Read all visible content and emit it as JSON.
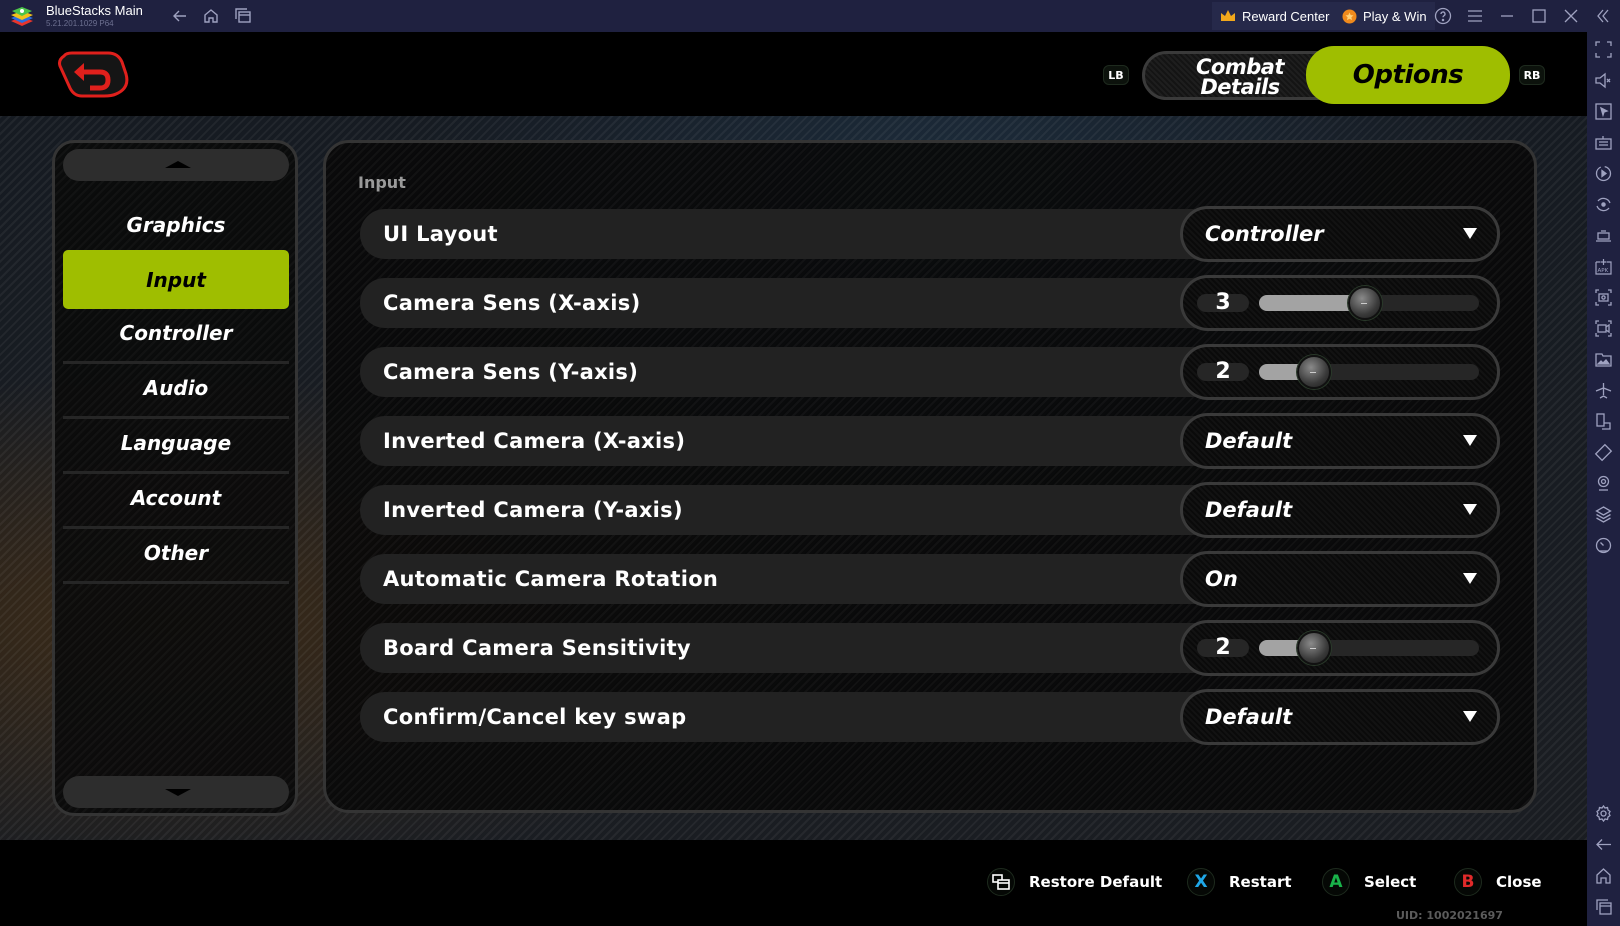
{
  "titlebar": {
    "app_title": "BlueStacks Main",
    "version": "5.21.201.1029  P64",
    "nav_icons": [
      "back-arrow-icon",
      "home-icon",
      "multi-instance-icon"
    ],
    "reward_center": "Reward Center",
    "play_and_win": "Play & Win",
    "window_icons": [
      "help-icon",
      "menu-icon",
      "minimize-icon",
      "maximize-icon",
      "close-icon",
      "collapse-sidebar-icon"
    ]
  },
  "bs_sidebar": {
    "icons": [
      "fullscreen-icon",
      "mute-icon",
      "pointer-icon",
      "keyboard-icon",
      "macro-icon",
      "rotate-icon",
      "performance-icon",
      "install-apk-icon",
      "screenshot-icon",
      "record-icon",
      "media-folder-icon",
      "airplane-mode-icon",
      "multi-window-icon",
      "shake-icon",
      "location-icon",
      "layers-icon",
      "speed-icon"
    ],
    "bottom_icons": [
      "settings-icon",
      "back-icon",
      "home-icon",
      "recent-apps-icon"
    ]
  },
  "header": {
    "lb": "LB",
    "rb": "RB",
    "tabs": [
      {
        "label": "Combat Details",
        "active": false
      },
      {
        "label": "Options",
        "active": true
      }
    ],
    "accent_color": "#9fbe00",
    "back_color": "#e0201c"
  },
  "categories": [
    {
      "label": "Graphics",
      "active": false
    },
    {
      "label": "Input",
      "active": true
    },
    {
      "label": "Controller",
      "active": false
    },
    {
      "label": "Audio",
      "active": false
    },
    {
      "label": "Language",
      "active": false
    },
    {
      "label": "Account",
      "active": false
    },
    {
      "label": "Other",
      "active": false
    }
  ],
  "settings": {
    "section_title": "Input",
    "rows": [
      {
        "label": "UI Layout",
        "type": "dropdown",
        "value": "Controller"
      },
      {
        "label": "Camera Sens (X-axis)",
        "type": "slider",
        "value": "3",
        "fill_fraction": 0.48
      },
      {
        "label": "Camera Sens (Y-axis)",
        "type": "slider",
        "value": "2",
        "fill_fraction": 0.25
      },
      {
        "label": "Inverted Camera (X-axis)",
        "type": "dropdown",
        "value": "Default"
      },
      {
        "label": "Inverted Camera (Y-axis)",
        "type": "dropdown",
        "value": "Default"
      },
      {
        "label": "Automatic Camera Rotation",
        "type": "dropdown",
        "value": "On"
      },
      {
        "label": "Board Camera Sensitivity",
        "type": "slider",
        "value": "2",
        "fill_fraction": 0.25
      },
      {
        "label": "Confirm/Cancel key swap",
        "type": "dropdown",
        "value": "Default"
      }
    ]
  },
  "hints": [
    {
      "key": "",
      "icon": "restore-default-icon",
      "label": "Restore Default",
      "color": "#ffffff"
    },
    {
      "key": "X",
      "icon": "x-button-icon",
      "label": "Restart",
      "color": "#1fa8e8"
    },
    {
      "key": "A",
      "icon": "a-button-icon",
      "label": "Select",
      "color": "#19b34a"
    },
    {
      "key": "B",
      "icon": "b-button-icon",
      "label": "Close",
      "color": "#e02a2a"
    }
  ],
  "uid": "UID: 1002021697"
}
